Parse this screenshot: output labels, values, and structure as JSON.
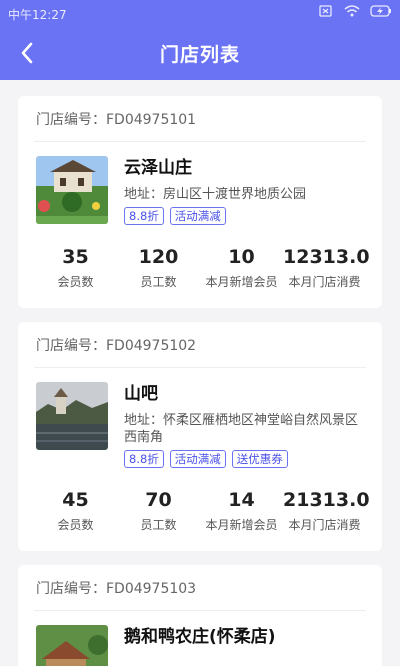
{
  "status": {
    "time": "中午12:27"
  },
  "nav": {
    "title": "门店列表"
  },
  "stores": [
    {
      "code_label": "门店编号：FD04975101",
      "name": "云泽山庄",
      "address": "地址：房山区十渡世界地质公园",
      "tags": [
        "8.8折",
        "活动满减"
      ],
      "stats": [
        {
          "value": "35",
          "label": "会员数"
        },
        {
          "value": "120",
          "label": "员工数"
        },
        {
          "value": "10",
          "label": "本月新增会员"
        },
        {
          "value": "12313.0",
          "label": "本月门店消费"
        }
      ]
    },
    {
      "code_label": "门店编号：FD04975102",
      "name": "山吧",
      "address": "地址：怀柔区雁栖地区神堂峪自然风景区西南角",
      "tags": [
        "8.8折",
        "活动满减",
        "送优惠券"
      ],
      "stats": [
        {
          "value": "45",
          "label": "会员数"
        },
        {
          "value": "70",
          "label": "员工数"
        },
        {
          "value": "14",
          "label": "本月新增会员"
        },
        {
          "value": "21313.0",
          "label": "本月门店消费"
        }
      ]
    },
    {
      "code_label": "门店编号：FD04975103",
      "name": "鹅和鸭农庄(怀柔店)",
      "address": "",
      "tags": [],
      "stats": []
    }
  ],
  "colors": {
    "header": "#6b73f5",
    "tag": "#4a52e8",
    "background": "#f4f4f6"
  }
}
